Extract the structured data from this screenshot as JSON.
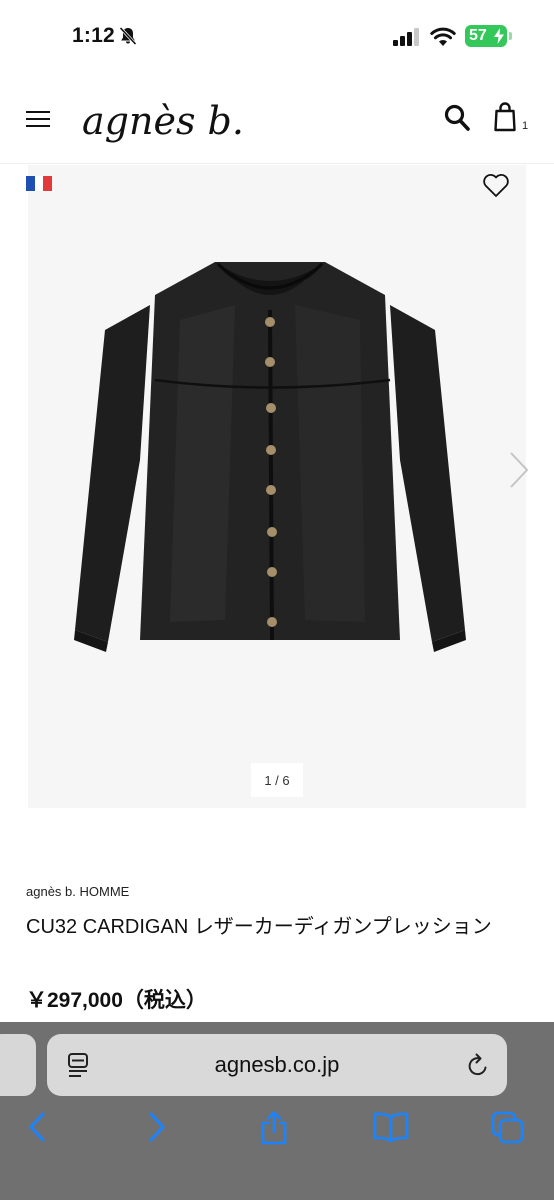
{
  "status_bar": {
    "time": "1:12",
    "battery": "57",
    "icons": [
      "bell-slash-icon",
      "signal-icon",
      "wifi-icon",
      "battery-charging-icon"
    ],
    "battery_color": "#34c759"
  },
  "header": {
    "logo_text": "agnès b.",
    "bag_count": "1",
    "icons": [
      "menu-icon",
      "search-icon",
      "bag-icon"
    ]
  },
  "gallery": {
    "flag": "french-flag-icon",
    "pagination": "1 / 6",
    "icons": [
      "heart-icon",
      "chevron-right-icon"
    ],
    "background": "#f6f6f6"
  },
  "product": {
    "brand": "agnès b. HOMME",
    "name": "CU32 CARDIGAN レザーカーディガンプレッション",
    "price": "￥297,000（税込）"
  },
  "browser": {
    "url": "agnesb.co.jp",
    "icons": [
      "reader-icon",
      "reload-icon",
      "back-icon",
      "forward-icon",
      "share-icon",
      "bookmarks-icon",
      "tabs-icon"
    ],
    "accent": "#1a84ff",
    "toolbar_color": "#707070"
  }
}
